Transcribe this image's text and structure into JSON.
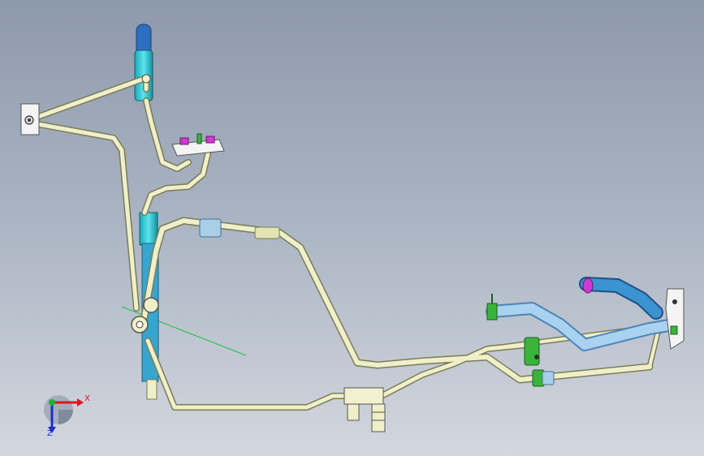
{
  "viewport": {
    "background_top": "#8d99ac",
    "background_bottom": "#d3d7de"
  },
  "colors": {
    "pipe_fill": "#efefc9",
    "pipe_outline": "#7b7b58",
    "hose_cyan": "#3fd0dc",
    "hose_blue": "#7fb8e6",
    "hose_dark_blue": "#2a63b8",
    "clip_green": "#3bb33b",
    "connector_magenta": "#d13ad1",
    "bracket_white": "#f4f4f4",
    "guide_line_green": "#19c43a"
  },
  "triad": {
    "x_label": "X",
    "z_label": "Z",
    "x_color": "#e0141e",
    "y_color": "#19b33a",
    "z_color": "#1d2fc7",
    "icon": "view-orientation-triad-icon"
  }
}
